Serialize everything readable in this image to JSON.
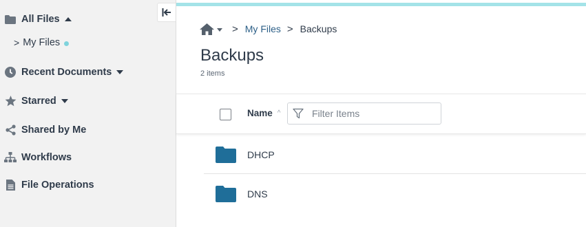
{
  "sidebar": {
    "collapse_icon": "collapse-left-icon",
    "items": [
      {
        "label": "All Files",
        "icon": "folder-icon"
      },
      {
        "label": "My Files"
      },
      {
        "label": "Recent Documents",
        "icon": "clock-icon"
      },
      {
        "label": "Starred",
        "icon": "star-icon"
      },
      {
        "label": "Shared by Me",
        "icon": "share-icon"
      },
      {
        "label": "Workflows",
        "icon": "workflow-icon"
      },
      {
        "label": "File Operations",
        "icon": "document-icon"
      }
    ],
    "sub_chevron": ">"
  },
  "breadcrumb": {
    "home_icon": "home-icon",
    "separator": ">",
    "items": [
      {
        "label": "My Files"
      },
      {
        "label": "Backups"
      }
    ]
  },
  "page": {
    "title": "Backups",
    "item_count": "2 items"
  },
  "table": {
    "column_name": "Name",
    "sort_indicator": "^",
    "filter_placeholder": "Filter Items",
    "rows": [
      {
        "name": "DHCP",
        "icon": "folder-icon"
      },
      {
        "name": "DNS",
        "icon": "folder-icon"
      }
    ]
  },
  "colors": {
    "accent_bar": "#a4e3e8",
    "folder": "#1f6e99",
    "link": "#2c5f87",
    "text": "#2f3b4a"
  }
}
